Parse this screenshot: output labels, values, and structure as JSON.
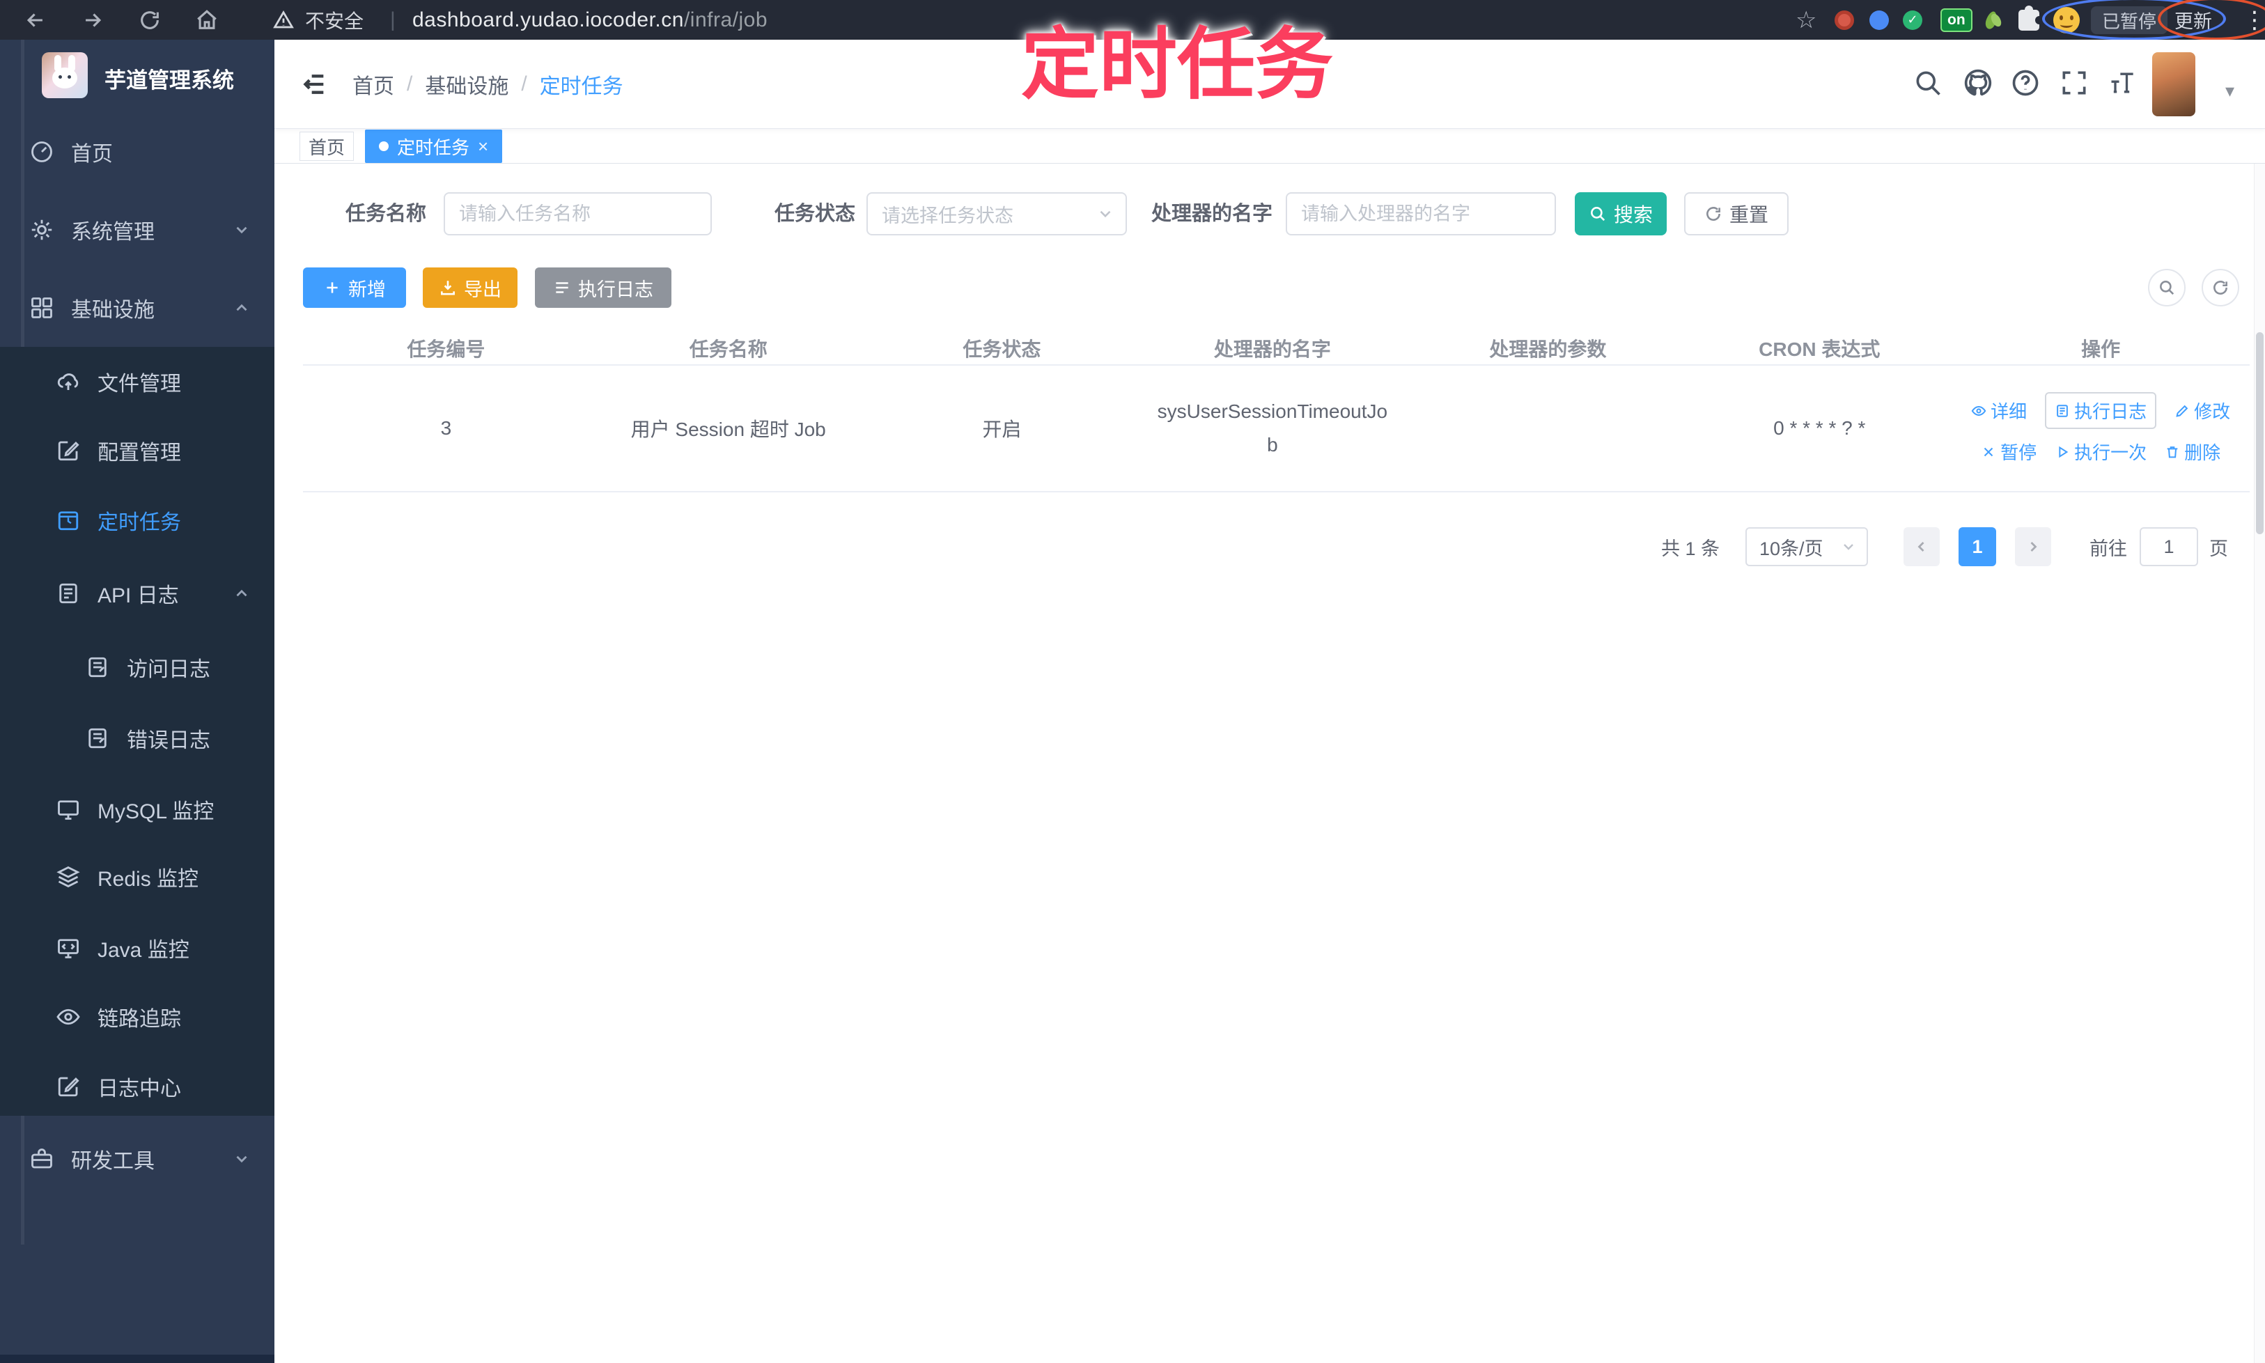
{
  "browser": {
    "security_label": "不安全",
    "url_host": "dashboard.yudao.iocoder.cn",
    "url_path": "/infra/job",
    "extension_on_badge": "on",
    "paused_badge": "已暂停",
    "update_button": "更新"
  },
  "icons": {
    "warning": "⚠",
    "pipe": "|",
    "star": "☆",
    "check": "✓",
    "kebab": "⋮",
    "caret": "▾",
    "close": "×"
  },
  "annotation": {
    "text": "定时任务"
  },
  "sidebar": {
    "title": "芋道管理系统",
    "items": [
      {
        "label": "首页"
      },
      {
        "label": "系统管理"
      },
      {
        "label": "基础设施"
      },
      {
        "label": "文件管理"
      },
      {
        "label": "配置管理"
      },
      {
        "label": "定时任务"
      },
      {
        "label": "API 日志"
      },
      {
        "label": "访问日志"
      },
      {
        "label": "错误日志"
      },
      {
        "label": "MySQL 监控"
      },
      {
        "label": "Redis 监控"
      },
      {
        "label": "Java 监控"
      },
      {
        "label": "链路追踪"
      },
      {
        "label": "日志中心"
      },
      {
        "label": "研发工具"
      }
    ]
  },
  "header": {
    "breadcrumb": {
      "items": [
        "首页",
        "基础设施",
        "定时任务"
      ],
      "separator": "/"
    }
  },
  "tags": {
    "home": "首页",
    "active": "定时任务"
  },
  "filters": {
    "name_label": "任务名称",
    "name_placeholder": "请输入任务名称",
    "status_label": "任务状态",
    "status_placeholder": "请选择任务状态",
    "handler_label": "处理器的名字",
    "handler_placeholder": "请输入处理器的名字",
    "search_button": "搜索",
    "reset_button": "重置"
  },
  "toolbar": {
    "add_button": "新增",
    "export_button": "导出",
    "log_button": "执行日志"
  },
  "table": {
    "columns": [
      "任务编号",
      "任务名称",
      "任务状态",
      "处理器的名字",
      "处理器的参数",
      "CRON 表达式",
      "操作"
    ],
    "row": {
      "id": "3",
      "name": "用户 Session 超时 Job",
      "status": "开启",
      "handler": "sysUserSessionTimeoutJob",
      "param": "",
      "cron": "0 * * * * ? *"
    },
    "actions": {
      "detail": "详细",
      "log": "执行日志",
      "edit": "修改",
      "pause": "暂停",
      "run_once": "执行一次",
      "delete": "删除"
    }
  },
  "pagination": {
    "total": "共 1 条",
    "page_size": "10条/页",
    "current_page": "1",
    "goto_label": "前往",
    "goto_value": "1",
    "page_unit": "页"
  },
  "colors": {
    "accent": "#409EFF",
    "search_button": "#23b7a3",
    "export_button": "#efa31d",
    "info_button": "#8f949c",
    "annotation": "#fb3e5e",
    "sidebar_bg": "#2d3a52",
    "submenu_bg": "#1f2d3d"
  }
}
